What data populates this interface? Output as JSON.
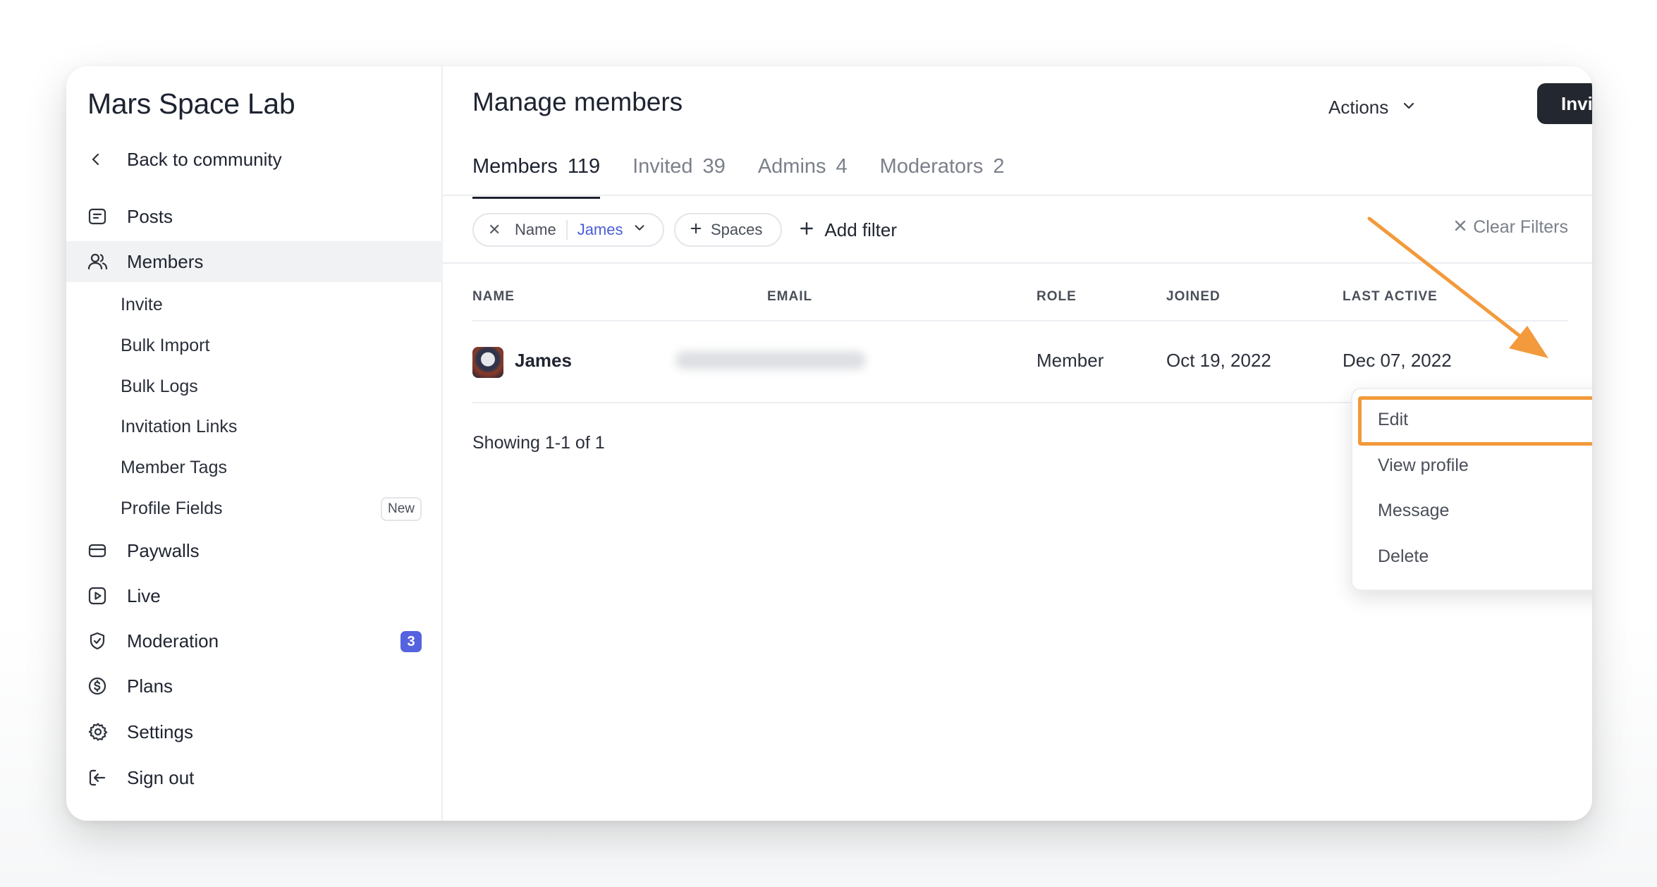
{
  "sidebar": {
    "community_name": "Mars Space Lab",
    "back_label": "Back to community",
    "items": [
      {
        "label": "Posts"
      },
      {
        "label": "Members"
      },
      {
        "label": "Paywalls"
      },
      {
        "label": "Live"
      },
      {
        "label": "Moderation",
        "badge": "3"
      },
      {
        "label": "Plans"
      },
      {
        "label": "Settings"
      },
      {
        "label": "Sign out"
      }
    ],
    "member_subitems": [
      {
        "label": "Invite"
      },
      {
        "label": "Bulk Import"
      },
      {
        "label": "Bulk Logs"
      },
      {
        "label": "Invitation Links"
      },
      {
        "label": "Member Tags"
      },
      {
        "label": "Profile Fields",
        "badge": "New"
      }
    ]
  },
  "header": {
    "title": "Manage members",
    "actions_label": "Actions",
    "invite_label": "Invite"
  },
  "tabs": [
    {
      "label": "Members",
      "count": "119",
      "active": true
    },
    {
      "label": "Invited",
      "count": "39"
    },
    {
      "label": "Admins",
      "count": "4"
    },
    {
      "label": "Moderators",
      "count": "2"
    }
  ],
  "filters": {
    "name_field": "Name",
    "name_value": "James",
    "spaces_label": "Spaces",
    "add_filter_label": "Add filter",
    "clear_label": "Clear Filters"
  },
  "table": {
    "columns": [
      "NAME",
      "EMAIL",
      "ROLE",
      "JOINED",
      "LAST ACTIVE"
    ],
    "rows": [
      {
        "name": "James",
        "email": "",
        "role": "Member",
        "joined": "Oct 19, 2022",
        "last_active": "Dec 07, 2022"
      }
    ],
    "showing": "Showing 1-1 of 1"
  },
  "row_menu": {
    "items": [
      "Edit",
      "View profile",
      "Message",
      "Delete"
    ],
    "highlighted": "Edit"
  },
  "colors": {
    "accent": "#4b5ed6",
    "badge": "#5563de",
    "annotation": "#f29a3c",
    "button_dark": "#23272f"
  }
}
